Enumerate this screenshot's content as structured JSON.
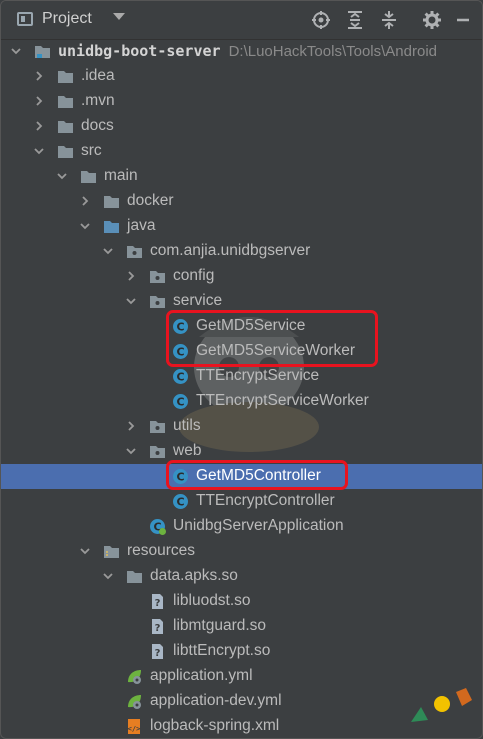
{
  "toolbar": {
    "title": "Project",
    "buttons": [
      "locate-icon",
      "expand-all-icon",
      "collapse-all-icon",
      "gear-icon",
      "hide-icon"
    ]
  },
  "tree": {
    "root_label": "unidbg-boot-server",
    "root_path": "D:\\LuoHackTools\\Tools\\Android",
    "items": [
      {
        "label": "unidbg-boot-server"
      },
      {
        "label": ".idea"
      },
      {
        "label": ".mvn"
      },
      {
        "label": "docs"
      },
      {
        "label": "src"
      },
      {
        "label": "main"
      },
      {
        "label": "docker"
      },
      {
        "label": "java"
      },
      {
        "label": "com.anjia.unidbgserver"
      },
      {
        "label": "config"
      },
      {
        "label": "service"
      },
      {
        "label": "GetMD5Service"
      },
      {
        "label": "GetMD5ServiceWorker"
      },
      {
        "label": "TTEncryptService"
      },
      {
        "label": "TTEncryptServiceWorker"
      },
      {
        "label": "utils"
      },
      {
        "label": "web"
      },
      {
        "label": "GetMD5Controller"
      },
      {
        "label": "TTEncryptController"
      },
      {
        "label": "UnidbgServerApplication"
      },
      {
        "label": "resources"
      },
      {
        "label": "data.apks.so"
      },
      {
        "label": "libluodst.so"
      },
      {
        "label": "libmtguard.so"
      },
      {
        "label": "libttEncrypt.so"
      },
      {
        "label": "application.yml"
      },
      {
        "label": "application-dev.yml"
      },
      {
        "label": "logback-spring.xml"
      }
    ],
    "selected_item": "GetMD5Controller"
  },
  "colors": {
    "background": "#3c3f41",
    "selection": "#4b6eaf",
    "highlight": "#e8131f",
    "folder": "#87939a",
    "class_icon": "#3592c4"
  }
}
